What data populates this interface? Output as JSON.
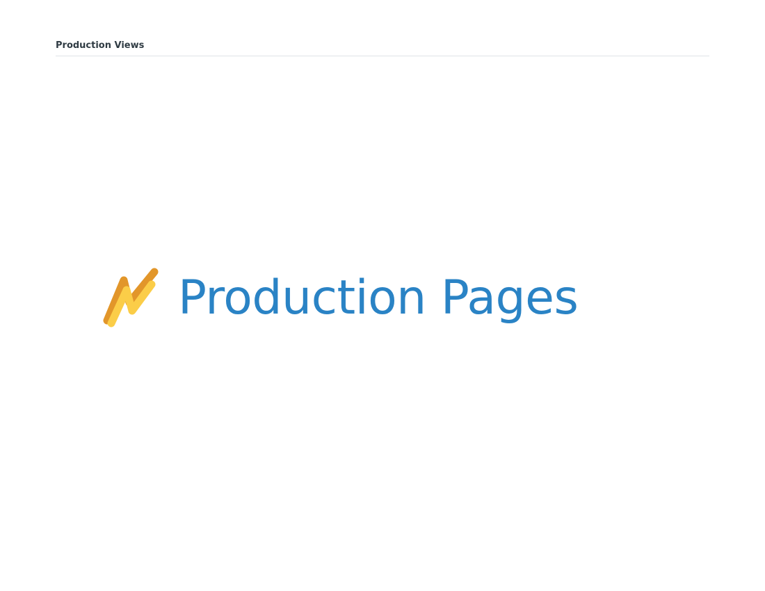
{
  "header": {
    "title": "Production Views"
  },
  "brand": {
    "logo_icon": "lightning-zigzag-icon",
    "name": "Production Pages"
  },
  "colors": {
    "brand_text": "#2a83c5",
    "logo_back": "#e2962a",
    "logo_front": "#fbcd48",
    "header_text": "#2f3b43",
    "divider": "#dfe3e6",
    "background": "#ffffff"
  }
}
